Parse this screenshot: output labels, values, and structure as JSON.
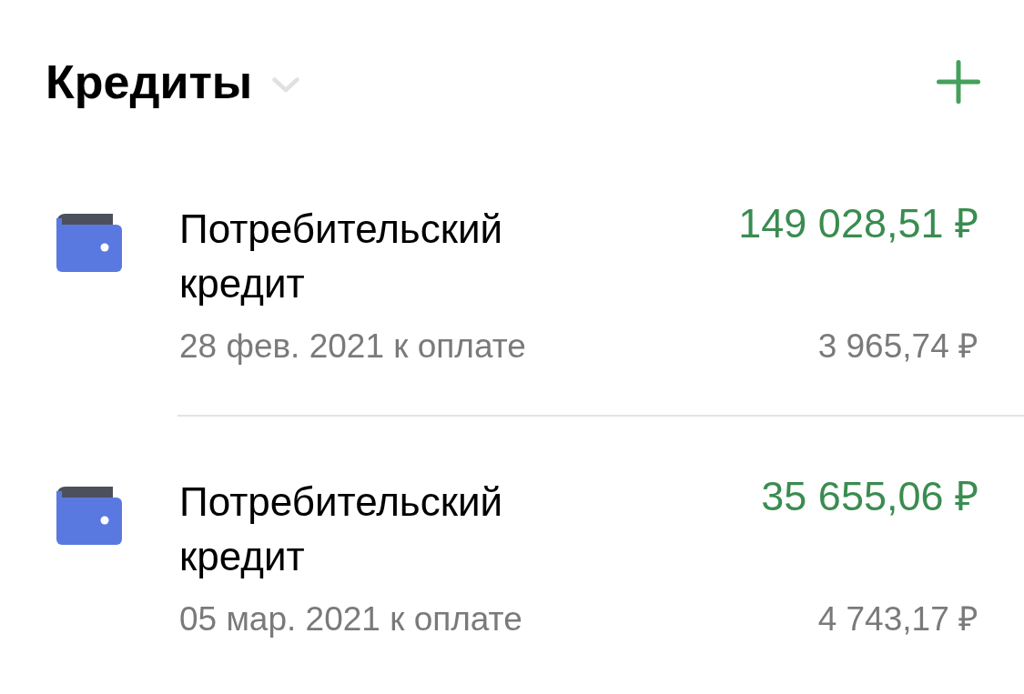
{
  "header": {
    "title": "Кредиты"
  },
  "loans": [
    {
      "name": "Потребительский кредит",
      "balance": "149 028,51 ₽",
      "due_date": "28 фев. 2021 к оплате",
      "payment": "3 965,74 ₽"
    },
    {
      "name": "Потребительский кредит",
      "balance": "35 655,06 ₽",
      "due_date": "05 мар. 2021 к оплате",
      "payment": "4 743,17 ₽"
    }
  ]
}
